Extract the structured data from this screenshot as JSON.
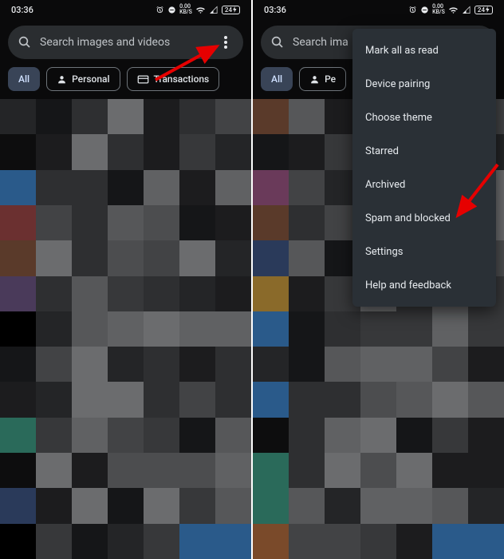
{
  "status": {
    "time": "03:36",
    "net_speed": "0.00",
    "net_unit": "KB/S",
    "battery": "24"
  },
  "search": {
    "placeholder": "Search images and videos",
    "placeholder_short": "Search ima"
  },
  "chips": {
    "all": "All",
    "personal": "Personal",
    "personal_short": "Pe",
    "transactions": "Transactions"
  },
  "menu": {
    "mark_read": "Mark all as read",
    "device_pairing": "Device pairing",
    "choose_theme": "Choose theme",
    "starred": "Starred",
    "archived": "Archived",
    "spam_blocked": "Spam and blocked",
    "settings": "Settings",
    "help": "Help and feedback"
  }
}
